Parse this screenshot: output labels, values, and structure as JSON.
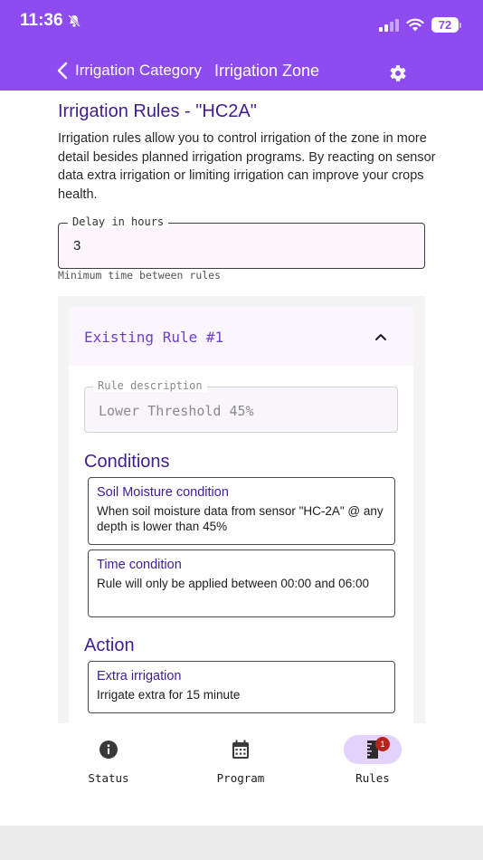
{
  "status_bar": {
    "time": "11:36",
    "battery": "72"
  },
  "nav": {
    "breadcrumb_parent": "Irrigation Category",
    "breadcrumb_current": "Irrigation Zone"
  },
  "page": {
    "title": "Irrigation Rules - \"HC2A\"",
    "intro": "Irrigation rules allow you to control irrigation of the zone in more detail besides planned irrigation programs. By reacting on sensor data extra irrigation or limiting irrigation can improve your crops health."
  },
  "delay": {
    "label": "Delay in hours",
    "value": "3",
    "helper": "Minimum time between rules"
  },
  "rule": {
    "title": "Existing Rule #1",
    "description_label": "Rule description",
    "description_value": "Lower Threshold 45%",
    "conditions_heading": "Conditions",
    "conditions": [
      {
        "title": "Soil Moisture condition",
        "text": "When soil moisture data from sensor \"HC-2A\" @ any depth is lower than 45%"
      },
      {
        "title": "Time condition",
        "text": "Rule will only be applied between 00:00 and 06:00"
      }
    ],
    "action_heading": "Action",
    "action": {
      "title": "Extra irrigation",
      "text": "Irrigate extra for 15 minute"
    }
  },
  "bottom_nav": [
    {
      "label": "Status",
      "icon": "info-icon"
    },
    {
      "label": "Program",
      "icon": "calendar-icon"
    },
    {
      "label": "Rules",
      "icon": "ruler-icon",
      "badge": "1",
      "active": true
    }
  ],
  "colors": {
    "header": "#8e4bf0",
    "primary_text": "#3f1d95",
    "accent": "#6f3fd0",
    "active_pill": "#e3d2fb",
    "badge": "#b3261e"
  }
}
